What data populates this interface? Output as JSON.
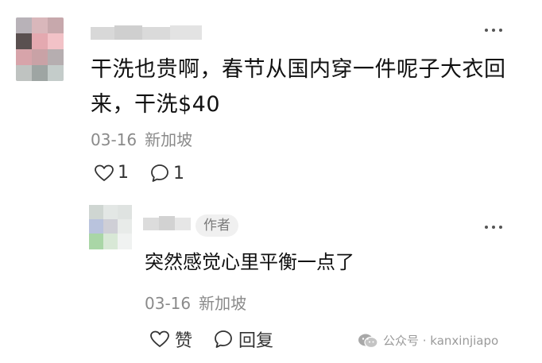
{
  "comment": {
    "text": "干洗也贵啊，春节从国内穿一件呢子大衣回来，干洗$40",
    "date": "03-16",
    "location": "新加坡",
    "likes": "1",
    "replies": "1"
  },
  "reply": {
    "author_tag": "作者",
    "text": "突然感觉心里平衡一点了",
    "date": "03-16",
    "location": "新加坡",
    "like_label": "赞",
    "reply_label": "回复"
  },
  "watermark": {
    "text": "公众号 · kanxinjiapo"
  },
  "icons": [
    "more-icon",
    "heart-icon",
    "comment-icon",
    "wechat-icon"
  ],
  "colors": {
    "text": "#111111",
    "meta": "#8a8a8a",
    "tag_bg": "#f0f0f0"
  }
}
